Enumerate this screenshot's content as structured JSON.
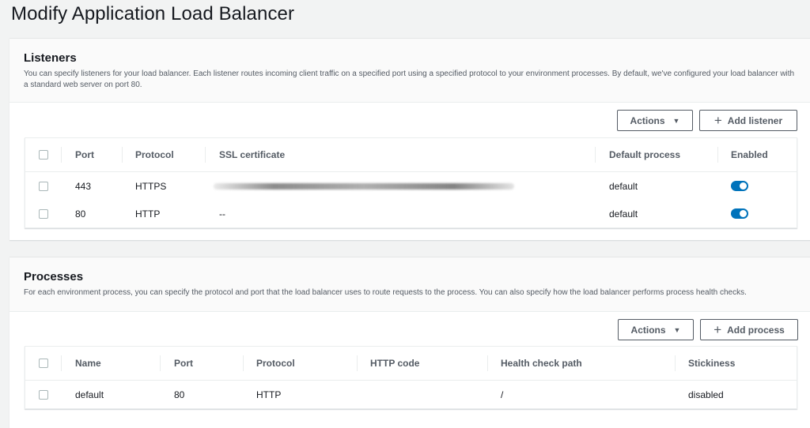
{
  "page": {
    "title": "Modify Application Load Balancer"
  },
  "listeners": {
    "title": "Listeners",
    "description": "You can specify listeners for your load balancer. Each listener routes incoming client traffic on a specified port using a specified protocol to your environment processes. By default, we've configured your load balancer with a standard web server on port 80.",
    "actions_label": "Actions",
    "add_label": "Add listener",
    "columns": [
      "Port",
      "Protocol",
      "SSL certificate",
      "Default process",
      "Enabled"
    ],
    "rows": [
      {
        "port": "443",
        "protocol": "HTTPS",
        "ssl": "",
        "process": "default",
        "enabled": true
      },
      {
        "port": "80",
        "protocol": "HTTP",
        "ssl": "--",
        "process": "default",
        "enabled": true
      }
    ]
  },
  "processes": {
    "title": "Processes",
    "description": "For each environment process, you can specify the protocol and port that the load balancer uses to route requests to the process. You can also specify how the load balancer performs process health checks.",
    "actions_label": "Actions",
    "add_label": "Add process",
    "columns": [
      "Name",
      "Port",
      "Protocol",
      "HTTP code",
      "Health check path",
      "Stickiness"
    ],
    "rows": [
      {
        "name": "default",
        "port": "80",
        "protocol": "HTTP",
        "http_code": "",
        "health_path": "/",
        "stickiness": "disabled"
      }
    ]
  },
  "colors": {
    "toggle_on": "#0073bb",
    "text": "#16191f",
    "muted": "#545b64"
  }
}
